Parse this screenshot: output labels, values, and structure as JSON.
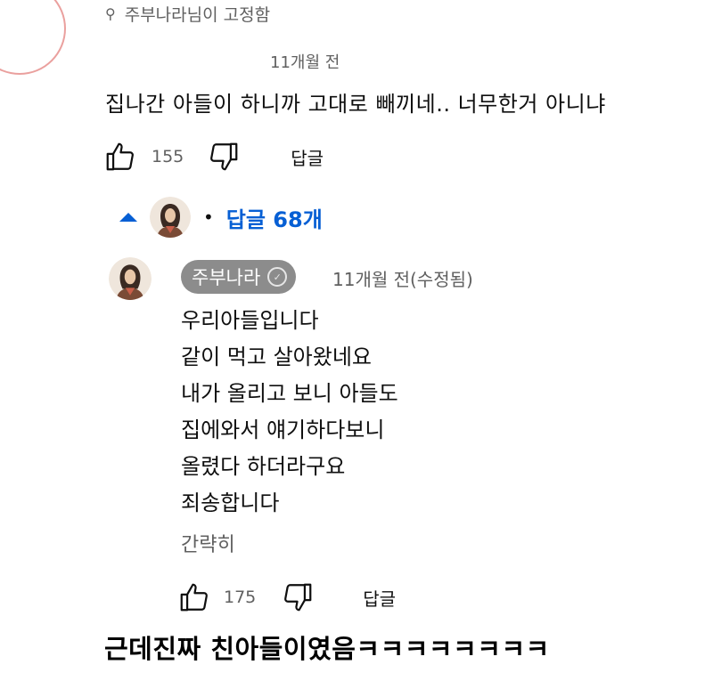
{
  "pinned": {
    "label": "주부나라님이 고정함"
  },
  "comment": {
    "time": "11개월 전",
    "text": "집나간 아들이 하니까 고대로 빼끼네.. 너무한거 아니냐",
    "likes": "155",
    "reply_label": "답글"
  },
  "replies": {
    "toggle_label": "답글 68개",
    "dot": "•"
  },
  "reply": {
    "author": "주부나라",
    "meta": "11개월 전(수정됨)",
    "lines": [
      "우리아들입니다",
      "같이 먹고 살아왔네요",
      "내가 올리고 보니 아들도",
      "집에와서 얘기하다보니",
      "올렸다 하더라구요",
      "죄송합니다"
    ],
    "collapse_label": "간략히",
    "likes": "175",
    "reply_label": "답글"
  },
  "caption": "근데진짜 친아들이였음ㅋㅋㅋㅋㅋㅋㅋㅋ",
  "colors": {
    "link_blue": "#065fd4",
    "secondary_text": "#606060",
    "chip_gray": "#8c8c8c"
  },
  "icons": [
    "pin-icon",
    "thumbs-up-icon",
    "thumbs-down-icon",
    "caret-up-icon",
    "verified-check-icon"
  ]
}
